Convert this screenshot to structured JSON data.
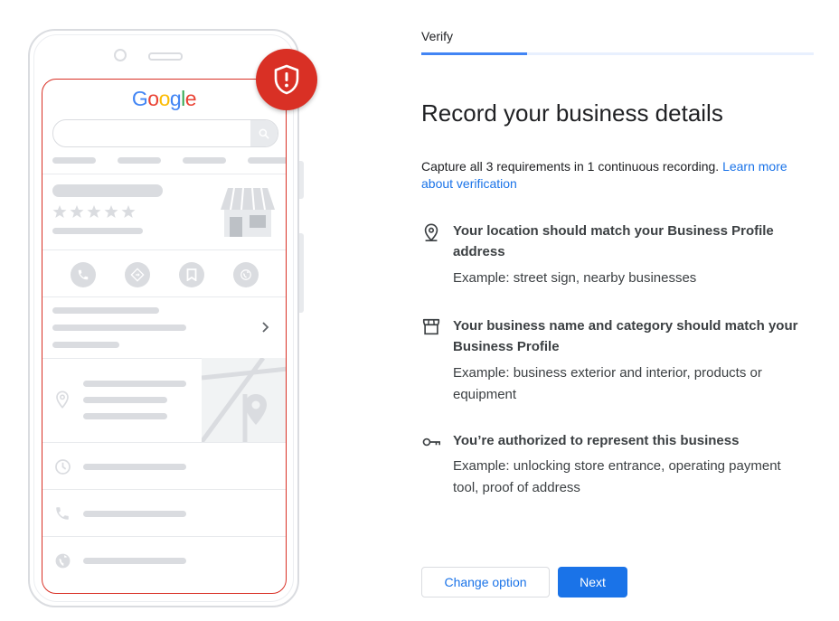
{
  "illustration": {
    "logo_letters": [
      "G",
      "o",
      "o",
      "g",
      "l",
      "e"
    ],
    "shield_badge_color": "#d93025",
    "icons": [
      "search-icon",
      "phone-icon",
      "directions-icon",
      "bookmark-icon",
      "globe-icon",
      "chevron-right-icon",
      "location-pin-icon",
      "clock-icon",
      "phone-icon",
      "globe-icon",
      "storefront-icon",
      "map-pin-icon",
      "shield-alert-icon"
    ]
  },
  "header": {
    "tab_label": "Verify",
    "progress": 0.27
  },
  "main": {
    "title": "Record your business details",
    "intro_text": "Capture all 3 requirements in 1 continuous recording.",
    "learn_more_link": "Learn more about verification",
    "requirements": [
      {
        "icon": "location-pin-icon",
        "heading": "Your location should match your Business Profile address",
        "example": "Example: street sign, nearby businesses"
      },
      {
        "icon": "storefront-icon",
        "heading": "Your business name and category should match your Business Profile",
        "example": "Example: business exterior and interior, products or equipment"
      },
      {
        "icon": "key-icon",
        "heading": "You’re authorized to represent this business",
        "example": "Example: unlocking store entrance, operating payment tool, proof of address"
      }
    ]
  },
  "footer": {
    "change_option_label": "Change option",
    "next_label": "Next"
  },
  "colors": {
    "accent": "#1a73e8",
    "progress_blue": "#4285f4",
    "badge_red": "#d93025"
  }
}
